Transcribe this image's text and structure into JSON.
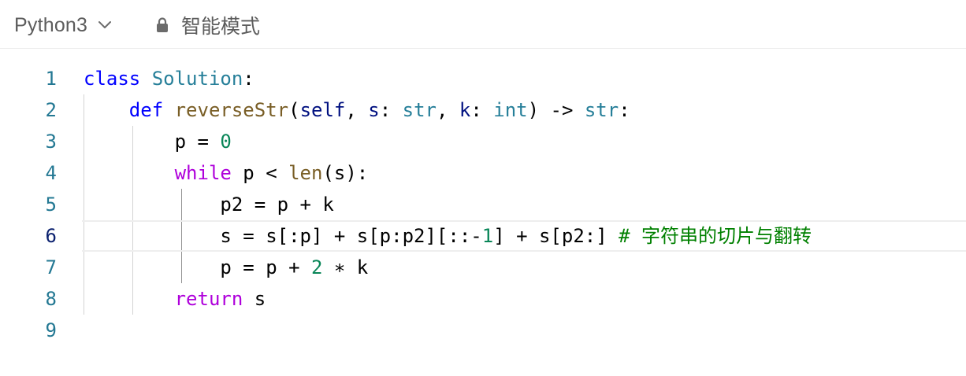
{
  "toolbar": {
    "language": "Python3",
    "mode_label": "智能模式",
    "icons": [
      "chevron-down-icon",
      "lock-icon"
    ]
  },
  "editor": {
    "active_line": 6,
    "lines": [
      {
        "number": "1",
        "tokens": [
          {
            "t": "class",
            "c": "kw"
          },
          {
            "t": " ",
            "c": "plain"
          },
          {
            "t": "Solution",
            "c": "cls"
          },
          {
            "t": ":",
            "c": "plain"
          }
        ]
      },
      {
        "number": "2",
        "tokens": [
          {
            "t": "    ",
            "c": "plain"
          },
          {
            "t": "def",
            "c": "kw"
          },
          {
            "t": " ",
            "c": "plain"
          },
          {
            "t": "reverseStr",
            "c": "fn"
          },
          {
            "t": "(",
            "c": "plain"
          },
          {
            "t": "self",
            "c": "param"
          },
          {
            "t": ", ",
            "c": "plain"
          },
          {
            "t": "s",
            "c": "param"
          },
          {
            "t": ": ",
            "c": "plain"
          },
          {
            "t": "str",
            "c": "cls"
          },
          {
            "t": ", ",
            "c": "plain"
          },
          {
            "t": "k",
            "c": "param"
          },
          {
            "t": ": ",
            "c": "plain"
          },
          {
            "t": "int",
            "c": "cls"
          },
          {
            "t": ") -> ",
            "c": "plain"
          },
          {
            "t": "str",
            "c": "cls"
          },
          {
            "t": ":",
            "c": "plain"
          }
        ]
      },
      {
        "number": "3",
        "tokens": [
          {
            "t": "        p = ",
            "c": "plain"
          },
          {
            "t": "0",
            "c": "num"
          }
        ]
      },
      {
        "number": "4",
        "tokens": [
          {
            "t": "        ",
            "c": "plain"
          },
          {
            "t": "while",
            "c": "ctrl"
          },
          {
            "t": " p < ",
            "c": "plain"
          },
          {
            "t": "len",
            "c": "fn"
          },
          {
            "t": "(s):",
            "c": "plain"
          }
        ]
      },
      {
        "number": "5",
        "tokens": [
          {
            "t": "            p2 = p + k",
            "c": "plain"
          }
        ]
      },
      {
        "number": "6",
        "tokens": [
          {
            "t": "            s = s[:p] + s[p:p2][::-",
            "c": "plain"
          },
          {
            "t": "1",
            "c": "num"
          },
          {
            "t": "] + s[p2:] ",
            "c": "plain"
          },
          {
            "t": "# 字符串的切片与翻转",
            "c": "cmt"
          }
        ]
      },
      {
        "number": "7",
        "tokens": [
          {
            "t": "            p = p + ",
            "c": "plain"
          },
          {
            "t": "2",
            "c": "num"
          },
          {
            "t": " ∗ k",
            "c": "plain"
          }
        ]
      },
      {
        "number": "8",
        "tokens": [
          {
            "t": "        ",
            "c": "plain"
          },
          {
            "t": "return",
            "c": "ctrl"
          },
          {
            "t": " s",
            "c": "plain"
          }
        ]
      },
      {
        "number": "9",
        "tokens": []
      }
    ]
  }
}
